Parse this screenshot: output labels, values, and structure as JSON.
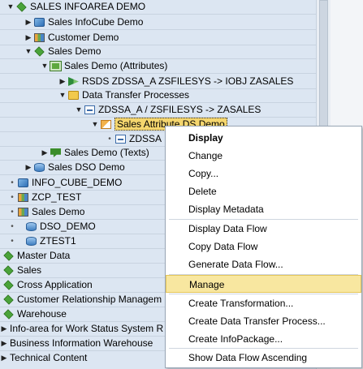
{
  "tree": {
    "rows": [
      {
        "label": "SALES INFOAREA DEMO",
        "toggle": "▼",
        "icon": "ic-diamond",
        "icon_name": "infoarea-icon"
      },
      {
        "label": "Sales InfoCube Demo",
        "toggle": "▶",
        "icon": "ic-cube",
        "icon_name": "infocube-icon"
      },
      {
        "label": "Customer Demo",
        "toggle": "▶",
        "icon": "ic-chart",
        "icon_name": "characteristic-icon"
      },
      {
        "label": "Sales Demo",
        "toggle": "▼",
        "icon": "ic-diamond",
        "icon_name": "infoarea-icon"
      },
      {
        "label": "Sales Demo (Attributes)",
        "toggle": "▼",
        "icon": "ic-multi",
        "icon_name": "attributes-icon"
      },
      {
        "label": "RSDS ZDSSA_A ZSFILESYS -> IOBJ ZASALES",
        "toggle": "▶",
        "icon": "ic-flag",
        "icon_name": "transformation-icon"
      },
      {
        "label": "Data Transfer Processes",
        "toggle": "▼",
        "icon": "ic-folder",
        "icon_name": "folder-icon"
      },
      {
        "label": "ZDSSA_A / ZSFILESYS -> ZASALES",
        "toggle": "▼",
        "icon": "ic-dtp",
        "icon_name": "dtp-icon"
      },
      {
        "label": "Sales Attribute DS Demo",
        "toggle": "▼",
        "icon": "ic-ipk",
        "icon_name": "infopackage-icon"
      },
      {
        "label": "ZDSSA",
        "toggle": "•",
        "icon": "ic-dtp",
        "icon_name": "datasource-icon"
      },
      {
        "label": "Sales Demo (Texts)",
        "toggle": "▶",
        "icon": "ic-text",
        "icon_name": "texts-icon"
      },
      {
        "label": "Sales DSO Demo",
        "toggle": "▶",
        "icon": "ic-cyl",
        "icon_name": "dso-icon"
      },
      {
        "label": "INFO_CUBE_DEMO",
        "toggle": "•",
        "icon": "ic-cube",
        "icon_name": "infocube-icon"
      },
      {
        "label": "ZCP_TEST",
        "toggle": "•",
        "icon": "ic-chart",
        "icon_name": "characteristic-icon"
      },
      {
        "label": "Sales Demo",
        "toggle": "•",
        "icon": "ic-chart",
        "icon_name": "characteristic-icon"
      },
      {
        "label": "DSO_DEMO",
        "toggle": "•",
        "icon": "ic-cyl",
        "icon_name": "dso-icon"
      },
      {
        "label": "ZTEST1",
        "toggle": "•",
        "icon": "ic-cyl",
        "icon_name": "dso-icon"
      },
      {
        "label": "Master Data",
        "toggle": "",
        "icon": "ic-diamond",
        "icon_name": "infoarea-icon"
      },
      {
        "label": "Sales",
        "toggle": "",
        "icon": "ic-diamond",
        "icon_name": "infoarea-icon"
      },
      {
        "label": "Cross Application",
        "toggle": "",
        "icon": "ic-diamond",
        "icon_name": "infoarea-icon"
      },
      {
        "label": "Customer Relationship Managem",
        "toggle": "",
        "icon": "ic-diamond",
        "icon_name": "infoarea-icon"
      },
      {
        "label": "Warehouse",
        "toggle": "",
        "icon": "ic-diamond",
        "icon_name": "infoarea-icon"
      },
      {
        "label": "Info-area for Work Status System R",
        "toggle": "▶",
        "icon": "",
        "icon_name": ""
      },
      {
        "label": "Business Information Warehouse",
        "toggle": "▶",
        "icon": "",
        "icon_name": ""
      },
      {
        "label": "Technical Content",
        "toggle": "▶",
        "icon": "",
        "icon_name": ""
      }
    ]
  },
  "context_menu": {
    "items": [
      {
        "label": "Display",
        "key": "display"
      },
      {
        "label": "Change",
        "key": "change"
      },
      {
        "label": "Copy...",
        "key": "copy"
      },
      {
        "label": "Delete",
        "key": "delete"
      },
      {
        "label": "Display Metadata",
        "key": "display-metadata"
      },
      {
        "label": "Display Data Flow",
        "key": "display-data-flow"
      },
      {
        "label": "Copy Data Flow",
        "key": "copy-data-flow"
      },
      {
        "label": "Generate Data Flow...",
        "key": "generate-data-flow"
      },
      {
        "label": "Manage",
        "key": "manage"
      },
      {
        "label": "Create Transformation...",
        "key": "create-transformation"
      },
      {
        "label": "Create Data Transfer Process...",
        "key": "create-dtp"
      },
      {
        "label": "Create InfoPackage...",
        "key": "create-infopackage"
      },
      {
        "label": "Show Data Flow Ascending",
        "key": "show-data-flow-ascending"
      }
    ]
  },
  "colors": {
    "tree_bg": "#dce6f2",
    "selection": "#f5d66e",
    "menu_highlight": "#f8e7a0"
  }
}
